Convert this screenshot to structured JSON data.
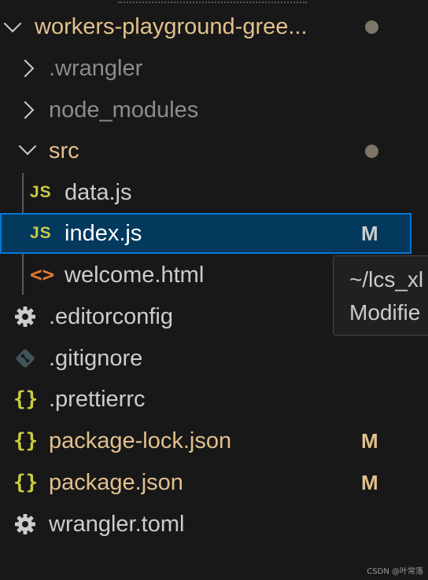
{
  "explorer": {
    "root_folder": {
      "name": "workers-playground-gree...",
      "chevron_icon": "chevron-down-icon",
      "status_dot": "modified-dot"
    },
    "items": [
      {
        "name": ".wrangler",
        "type": "folder",
        "state": "collapsed",
        "badge": ""
      },
      {
        "name": "node_modules",
        "type": "folder",
        "state": "collapsed",
        "badge": ""
      },
      {
        "name": "src",
        "type": "folder",
        "state": "expanded",
        "badge": "",
        "status_dot": "modified-dot"
      },
      {
        "name": "data.js",
        "type": "file",
        "icon": "js-file-icon",
        "icon_text": "JS",
        "badge": ""
      },
      {
        "name": "index.js",
        "type": "file",
        "icon": "js-file-icon",
        "icon_text": "JS",
        "badge": "M",
        "selected": true
      },
      {
        "name": "welcome.html",
        "type": "file",
        "icon": "html-file-icon",
        "icon_text": "<>",
        "badge": ""
      },
      {
        "name": ".editorconfig",
        "type": "file",
        "icon": "gear-icon",
        "badge": ""
      },
      {
        "name": ".gitignore",
        "type": "file",
        "icon": "git-icon",
        "badge": ""
      },
      {
        "name": ".prettierrc",
        "type": "file",
        "icon": "json-braces-icon",
        "icon_text": "{}",
        "badge": ""
      },
      {
        "name": "package-lock.json",
        "type": "file",
        "icon": "json-braces-icon",
        "icon_text": "{}",
        "badge": "M"
      },
      {
        "name": "package.json",
        "type": "file",
        "icon": "json-braces-icon",
        "icon_text": "{}",
        "badge": "M"
      },
      {
        "name": "wrangler.toml",
        "type": "file",
        "icon": "gear-icon",
        "badge": ""
      }
    ]
  },
  "tooltip": {
    "line1": "~/lcs_xl",
    "line2": "Modifie"
  },
  "watermark": "CSDN @叶常落",
  "colors": {
    "background": "#181818",
    "modified": "#e2c08d",
    "selection_bg": "#04395e",
    "selection_border": "#0078d4",
    "js_icon": "#cbcb41",
    "html_icon": "#e37933"
  }
}
